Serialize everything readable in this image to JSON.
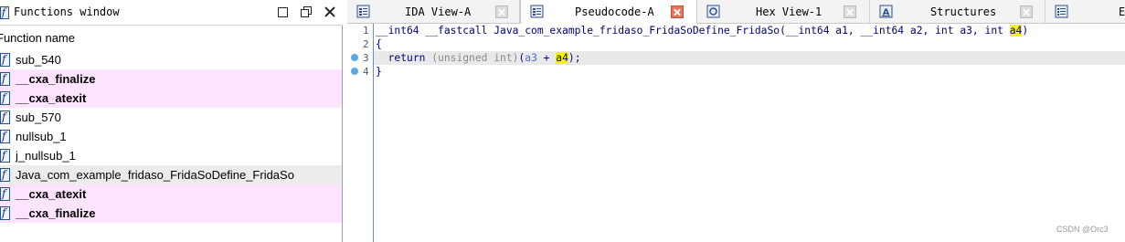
{
  "functions_window": {
    "title": "Functions window",
    "column_header": "Function name",
    "icon": "function-f-icon",
    "items": [
      {
        "name": "sub_540",
        "highlight": "none"
      },
      {
        "name": "__cxa_finalize",
        "highlight": "pink"
      },
      {
        "name": "__cxa_atexit",
        "highlight": "pink"
      },
      {
        "name": "sub_570",
        "highlight": "none"
      },
      {
        "name": "nullsub_1",
        "highlight": "none"
      },
      {
        "name": "j_nullsub_1",
        "highlight": "none"
      },
      {
        "name": "Java_com_example_fridaso_FridaSoDefine_FridaSo",
        "highlight": "selected"
      },
      {
        "name": "__cxa_atexit",
        "highlight": "pink"
      },
      {
        "name": "__cxa_finalize",
        "highlight": "pink"
      }
    ]
  },
  "tabs": [
    {
      "label": "IDA View-A",
      "icon": "ida-view-icon",
      "active": false
    },
    {
      "label": "Pseudocode-A",
      "icon": "pseudocode-icon",
      "active": true
    },
    {
      "label": "Hex View-1",
      "icon": "hex-view-icon",
      "active": false
    },
    {
      "label": "Structures",
      "icon": "structures-icon",
      "active": false
    },
    {
      "label": "E",
      "icon": "enums-icon",
      "active": false
    }
  ],
  "code": {
    "line_numbers": [
      "1",
      "2",
      "3",
      "4"
    ],
    "line1": {
      "prefix": "__int64 __fastcall Java_com_example_fridaso_FridaSoDefine_FridaSo(__int64 a1, __int64 a2, int a3, int ",
      "highlight": "a4",
      "suffix": ")"
    },
    "line2": "{",
    "line3": {
      "kw": "return",
      "cast": "(unsigned int)",
      "open": "(",
      "a3": "a3",
      "plus": " + ",
      "a4": "a4",
      "close": ");"
    },
    "line4": "}"
  },
  "watermark": "CSDN @Orc3",
  "colors": {
    "pink_row": "#ffe4ff",
    "selected_row": "#ececec",
    "code_text": "#000080",
    "highlight": "#f6f600",
    "active_tab_close": "#e8715a",
    "breakpoint": "#5aa9e6"
  }
}
